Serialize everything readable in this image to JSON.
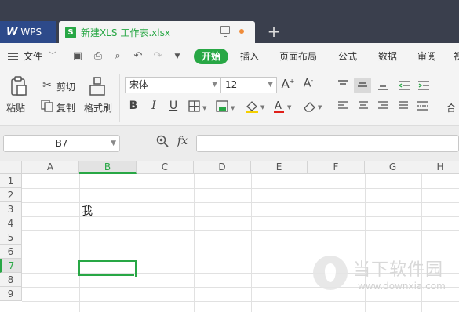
{
  "app": {
    "wps_label": "WPS",
    "doc_icon_letter": "S",
    "doc_title": "新建XLS 工作表.xlsx",
    "new_tab_glyph": "+"
  },
  "menu": {
    "file_label": "文件",
    "start_label": "开始",
    "items": [
      "插入",
      "页面布局",
      "公式",
      "数据",
      "审阅",
      "视"
    ]
  },
  "ribbon": {
    "paste_label": "粘贴",
    "cut_label": "剪切",
    "copy_label": "复制",
    "format_painter_label": "格式刷",
    "font_name": "宋体",
    "font_size": "12",
    "merge_label": "合"
  },
  "formula_bar": {
    "name_box": "B7",
    "fx_label": "fx",
    "formula_value": ""
  },
  "grid": {
    "columns": [
      "A",
      "B",
      "C",
      "D",
      "E",
      "F",
      "G",
      "H"
    ],
    "rows": [
      "1",
      "2",
      "3",
      "4",
      "5",
      "6",
      "7",
      "8",
      "9"
    ],
    "selected_column": "B",
    "selected_row": "7",
    "cell_B3": "我"
  },
  "watermark": {
    "text": "当下软件园",
    "url": "www.downxia.com"
  },
  "colors": {
    "accent": "#28a745",
    "title_bg": "#3a3f4d",
    "wps_tab_bg": "#2d4a8a"
  }
}
